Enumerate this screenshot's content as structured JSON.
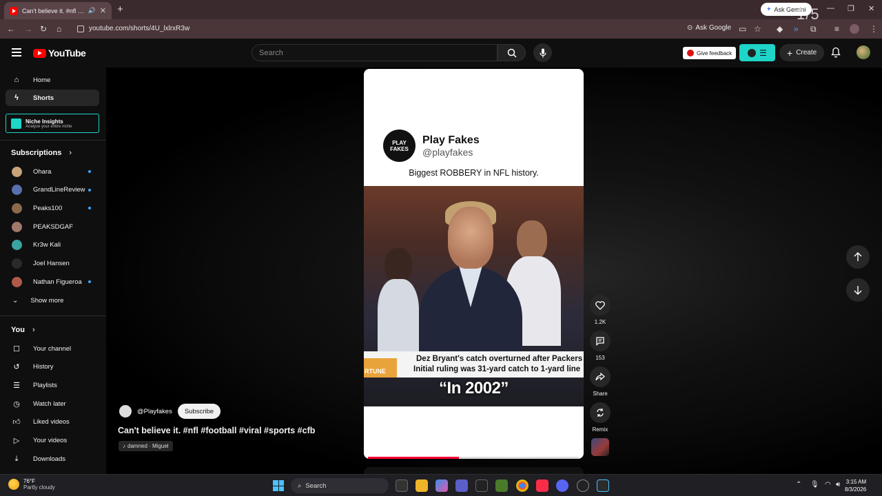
{
  "browser": {
    "tab_title": "Can't believe it. #nfl #football",
    "url": "youtube.com/shorts/4U_lxlrxR3w",
    "ask_google": "Ask Google",
    "ask_gemini": "Ask Gemini",
    "page_counter": "1/5"
  },
  "header": {
    "logo_text": "YouTube",
    "search_placeholder": "Search",
    "give_feedback": "Give feedback",
    "create_label": "Create"
  },
  "sidebar": {
    "nav": [
      {
        "label": "Home",
        "icon": "home-icon"
      },
      {
        "label": "Shorts",
        "icon": "shorts-icon"
      }
    ],
    "niche": {
      "title": "Niche Insights",
      "subtitle": "Analyze your entire niche"
    },
    "subscriptions_header": "Subscriptions",
    "subscriptions": [
      {
        "label": "Ohara",
        "new": true,
        "color": "#c9a27a"
      },
      {
        "label": "GrandLineReview",
        "new": true,
        "color": "#5a6fb0"
      },
      {
        "label": "Peaks100",
        "new": true,
        "color": "#8a6a4a"
      },
      {
        "label": "PEAKSDGAF",
        "new": false,
        "color": "#a0786a"
      },
      {
        "label": "Kr3w Kali",
        "new": false,
        "color": "#3aa3a0"
      },
      {
        "label": "Joel Hansen",
        "new": false,
        "color": "#2a2a2a"
      },
      {
        "label": "Nathan Figueroa",
        "new": true,
        "color": "#b05a4a"
      }
    ],
    "show_more": "Show more",
    "you_header": "You",
    "you_items": [
      {
        "label": "Your channel",
        "icon": "channel-icon"
      },
      {
        "label": "History",
        "icon": "history-icon"
      },
      {
        "label": "Playlists",
        "icon": "playlists-icon"
      },
      {
        "label": "Watch later",
        "icon": "watch-later-icon"
      },
      {
        "label": "Liked videos",
        "icon": "like-icon"
      },
      {
        "label": "Your videos",
        "icon": "your-videos-icon"
      },
      {
        "label": "Downloads",
        "icon": "download-icon"
      }
    ]
  },
  "short": {
    "account_name": "Play Fakes",
    "account_handle": "@playfakes",
    "logo_text": "PLAY FAKES",
    "tweet_text": "Biggest ROBBERY in NFL history.",
    "lower_third_line1": "Dez Bryant's catch overturned after Packers",
    "lower_third_line2": "Initial ruling was 31-yard catch to 1-yard line",
    "lower_third_brand": "RTUNE",
    "caption": "“In 2002”",
    "progress_fraction": 0.43
  },
  "actions": {
    "likes": "1.2K",
    "comments": "153",
    "share": "Share",
    "remix": "Remix"
  },
  "channel": {
    "name": "@Playfakes",
    "subscribe": "Subscribe",
    "title": "Can't believe it. #nfl #football #viral #sports #cfb",
    "music": "damned · Miguel"
  },
  "taskbar": {
    "temp": "76°F",
    "weather": "Partly cloudy",
    "search": "Search",
    "time": "3:15 AM",
    "date": "8/3/2026"
  }
}
